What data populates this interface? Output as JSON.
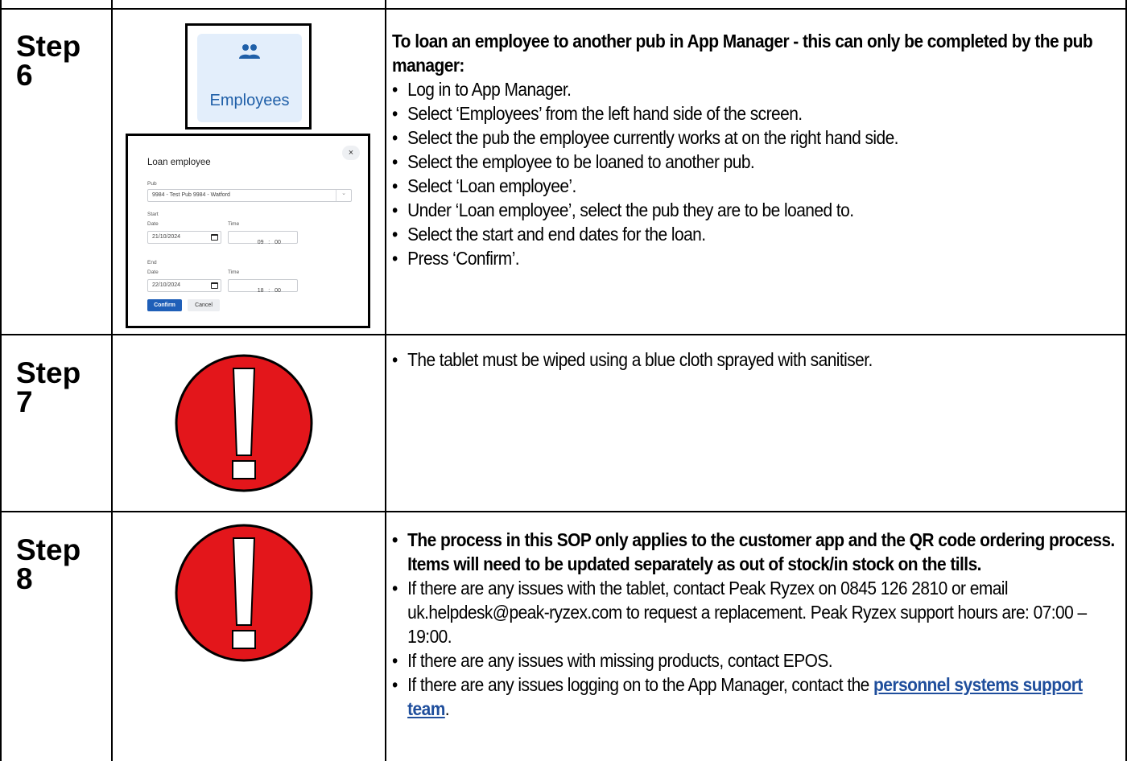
{
  "steps": [
    {
      "label": "Step\n6",
      "heading": "To loan an employee to another pub in App Manager - this can only be completed by the pub manager:",
      "bullets": [
        "Log in to App Manager.",
        "Select ‘Employees’ from the left hand side of the screen.",
        "Select the pub the employee currently works at on the right hand side.",
        "Select the employee to be loaned to another pub.",
        "Select ‘Loan employee’.",
        "Under ‘Loan employee’, select the pub they are to be loaned to.",
        "Select the start and end dates for the loan.",
        "Press ‘Confirm’."
      ]
    },
    {
      "label": "Step\n7",
      "bullets": [
        "The tablet must be wiped using a blue cloth sprayed with sanitiser."
      ]
    },
    {
      "label": "Step\n8",
      "bold_bullet": "The process in this SOP only applies to the customer app and the QR code ordering process.  Items will need to be updated separately as out of stock/in stock on the tills.",
      "bullets": [
        "If there are any issues with the tablet, contact Peak Ryzex on 0845 126 2810 or email uk.helpdesk@peak-ryzex.com to request a replacement.  Peak Ryzex support hours are: 07:00 – 19:00.",
        "If there are any issues with missing products, contact EPOS."
      ],
      "last_bullet_prefix": "If there are any issues logging on to the App Manager, contact the ",
      "last_bullet_link": "personnel systems support team",
      "last_bullet_suffix": "."
    }
  ],
  "employees_tile": {
    "label": "Employees",
    "icon": "people-icon"
  },
  "dialog": {
    "title": "Loan employee",
    "pub_label": "Pub",
    "pub_value": "9984 - Test Pub 9984 - Watford",
    "start_label": "Start",
    "end_label": "End",
    "date_label": "Date",
    "time_label": "Time",
    "start_date": "21/10/2024",
    "start_time": "09   :   00",
    "end_date": "22/10/2024",
    "end_time": "18   :   00",
    "confirm": "Confirm",
    "cancel": "Cancel",
    "close": "×"
  },
  "colors": {
    "warning_red": "#e3161b",
    "link_blue": "#1f4e9c",
    "tile_bg": "#e3eefb"
  },
  "warning_icon": "exclamation-warning-icon"
}
